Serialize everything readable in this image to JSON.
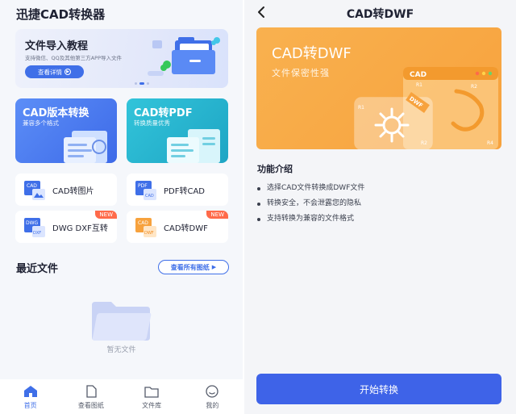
{
  "left": {
    "app_title": "迅捷CAD转换器",
    "banner": {
      "title": "文件导入教程",
      "subtitle": "支持微信、QQ及其他第三方APP导入文件",
      "button_label": "查看详情"
    },
    "cards": [
      {
        "title": "CAD版本转换",
        "subtitle": "兼容多个格式",
        "color": "#3d6ae8"
      },
      {
        "title": "CAD转PDF",
        "subtitle": "转换质量优秀",
        "color": "#1ea5c4"
      }
    ],
    "tools": [
      {
        "label": "CAD转图片",
        "icon": "cad-image-icon"
      },
      {
        "label": "PDF转CAD",
        "icon": "pdf-cad-icon"
      },
      {
        "label": "DWG DXF互转",
        "icon": "dwg-dxf-icon",
        "badge": "NEW"
      },
      {
        "label": "CAD转DWF",
        "icon": "cad-dwf-icon",
        "badge": "NEW"
      }
    ],
    "recent": {
      "title": "最近文件",
      "view_all": "查看所有图纸",
      "empty_text": "暂无文件"
    },
    "tabbar": [
      {
        "label": "首页",
        "icon": "home-icon",
        "active": true
      },
      {
        "label": "查看图纸",
        "icon": "document-icon",
        "active": false
      },
      {
        "label": "文件库",
        "icon": "folder-icon",
        "active": false
      },
      {
        "label": "我的",
        "icon": "profile-icon",
        "active": false
      }
    ]
  },
  "right": {
    "page_title": "CAD转DWF",
    "hero": {
      "title": "CAD转DWF",
      "subtitle": "文件保密性强",
      "window_label": "CAD",
      "tag": "DWF",
      "markers": [
        "R1",
        "R2",
        "R1",
        "R2",
        "R4"
      ]
    },
    "features_title": "功能介绍",
    "features": [
      "选择CAD文件转换成DWF文件",
      "转换安全，不会泄露您的隐私",
      "支持转换为兼容的文件格式"
    ],
    "start_button": "开始转换"
  },
  "colors": {
    "accent": "#3e63e8",
    "hero_orange": "#f7a23d",
    "badge_red": "#ff6a4a"
  }
}
